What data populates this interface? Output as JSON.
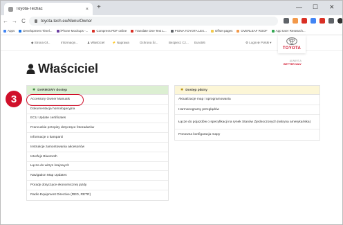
{
  "browser": {
    "tab_title": "Toyota-Techac",
    "tab_close": "×",
    "new_tab": "+",
    "url": "toyota-tech.eu/Menu/Owner",
    "nav_back": "←",
    "nav_forward": "→",
    "nav_reload": "C",
    "window_minimize": "—",
    "window_maximize": "☐",
    "window_close": "✕"
  },
  "bookmarks": [
    {
      "label": "Apps",
      "color": "#4285f4"
    },
    {
      "label": "Development Timel...",
      "color": "#1a73e8"
    },
    {
      "label": "iPhone Mockups -...",
      "color": "#6b3fa0"
    },
    {
      "label": "Compress PDF online",
      "color": "#d93025"
    },
    {
      "label": "Translate One Text L...",
      "color": "#d93025"
    },
    {
      "label": "PIONA TOYOTA LEX...",
      "color": "#5f6368"
    },
    {
      "label": "Offset pages",
      "color": "#f2c94c"
    },
    {
      "label": "OVERLEAF ROOF",
      "color": "#f2994a"
    },
    {
      "label": "App User Research...",
      "color": "#34a853"
    }
  ],
  "site_nav": [
    {
      "label": "◆ Strona Gł..."
    },
    {
      "label": "Informacje..."
    },
    {
      "label": "♟ Właściciel"
    },
    {
      "label": "⚡ Naprawa"
    },
    {
      "label": "Ochrona Śr..."
    },
    {
      "label": "Bezpiecz Cz..."
    },
    {
      "label": "Euro5/6"
    },
    {
      "label": "⚙ Login"
    },
    {
      "label": "⊕ Polski ▾"
    }
  ],
  "logo": {
    "text": "TOYOTA",
    "tagline1": "ALWAYS A",
    "tagline2": "BETTER WAY"
  },
  "page": {
    "title": "Właściciel"
  },
  "left_panel": {
    "header": "DARMOWY dostęp",
    "items": [
      "Accessory Owner Manuals",
      "Dokumentacja homologacyjna",
      "ECU Update certificates",
      "Francuskie przepisy dotyczące fotoradarów",
      "Informacje o kampanii",
      "Instrukcje zamontowania akcesoriów",
      "Interfejs Bluetooth",
      "Łącza do witryn krajowych",
      "Navigation Map Updates",
      "Porady dotyczące ekonomicznej jazdy",
      "Radio Equipment Directive (RED, RETR)"
    ]
  },
  "right_panel": {
    "header": "Dostęp płatny",
    "items": [
      "Aktualizacje map i oprogramowania",
      "Harmonogramy przeglądów",
      "Łącze do pojazdów o specyfikacji na rynek Stanów Zjednoczonych (witryna amerykańska)",
      "Ponowna konfiguracja mapy"
    ]
  },
  "annotation": {
    "step": "3"
  },
  "colors": {
    "accent_red": "#d0102a",
    "free_header": "#dcefd2",
    "paid_header": "#fcf6d7"
  }
}
